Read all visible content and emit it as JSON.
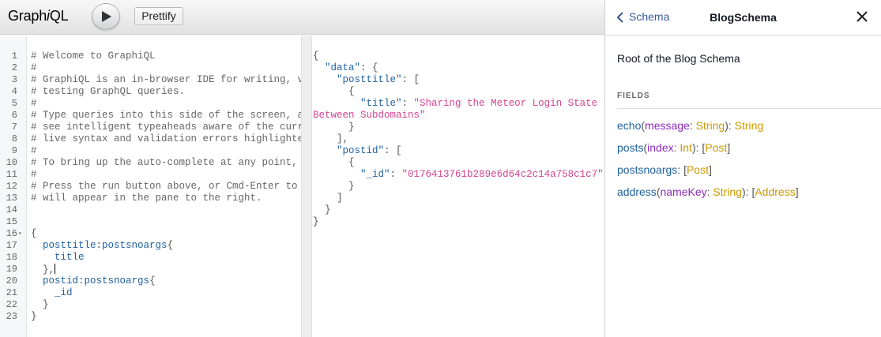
{
  "toolbar": {
    "logo": "GraphiQL",
    "prettify_label": "Prettify"
  },
  "query_editor": {
    "lines": [
      {
        "n": "1",
        "text": "# Welcome to GraphiQL",
        "kind": "comment"
      },
      {
        "n": "2",
        "text": "#",
        "kind": "comment"
      },
      {
        "n": "3",
        "text": "# GraphiQL is an in-browser IDE for writing, val",
        "kind": "comment"
      },
      {
        "n": "4",
        "text": "# testing GraphQL queries.",
        "kind": "comment"
      },
      {
        "n": "5",
        "text": "#",
        "kind": "comment"
      },
      {
        "n": "6",
        "text": "# Type queries into this side of the screen, and",
        "kind": "comment"
      },
      {
        "n": "7",
        "text": "# see intelligent typeaheads aware of the curren",
        "kind": "comment"
      },
      {
        "n": "8",
        "text": "# live syntax and validation errors highlighted",
        "kind": "comment"
      },
      {
        "n": "9",
        "text": "#",
        "kind": "comment"
      },
      {
        "n": "10",
        "text": "# To bring up the auto-complete at any point, ju",
        "kind": "comment"
      },
      {
        "n": "11",
        "text": "#",
        "kind": "comment"
      },
      {
        "n": "12",
        "text": "# Press the run button above, or Cmd-Enter to ex",
        "kind": "comment"
      },
      {
        "n": "13",
        "text": "# will appear in the pane to the right.",
        "kind": "comment"
      },
      {
        "n": "14",
        "text": "",
        "kind": "blank"
      },
      {
        "n": "15",
        "text": "",
        "kind": "blank"
      },
      {
        "n": "16",
        "text": "{",
        "kind": "punct",
        "fold": true
      },
      {
        "n": "17",
        "text": "  posttitle:postsnoargs{",
        "kind": "field"
      },
      {
        "n": "18",
        "text": "    title",
        "kind": "field"
      },
      {
        "n": "19",
        "text": "  },",
        "kind": "punct",
        "cursor": true
      },
      {
        "n": "20",
        "text": "  postid:postsnoargs{",
        "kind": "field"
      },
      {
        "n": "21",
        "text": "    _id",
        "kind": "field"
      },
      {
        "n": "22",
        "text": "  }",
        "kind": "punct"
      },
      {
        "n": "23",
        "text": "}",
        "kind": "punct"
      }
    ]
  },
  "result_viewer": {
    "lines": [
      {
        "text": "{",
        "fold": true
      },
      {
        "pre": "  ",
        "key": "\"data\"",
        "post": ": {",
        "fold": true
      },
      {
        "pre": "    ",
        "key": "\"posttitle\"",
        "post": ": [",
        "fold": true
      },
      {
        "pre": "      {",
        "fold": false
      },
      {
        "pre": "        ",
        "key": "\"title\"",
        "post": ": ",
        "str": "\"Sharing the Meteor Login State"
      },
      {
        "pre": "",
        "str": "Between Subdomains\""
      },
      {
        "pre": "      }"
      },
      {
        "pre": "    ],"
      },
      {
        "pre": "    ",
        "key": "\"postid\"",
        "post": ": [",
        "fold": true
      },
      {
        "pre": "      {"
      },
      {
        "pre": "        ",
        "key": "\"_id\"",
        "post": ": ",
        "str": "\"0176413761b289e6d64c2c14a758c1c7\""
      },
      {
        "pre": "      }"
      },
      {
        "pre": "    ]"
      },
      {
        "pre": "  }"
      },
      {
        "pre": "}"
      }
    ]
  },
  "doc_explorer": {
    "back_label": "Schema",
    "title": "BlogSchema",
    "description": "Root of the Blog Schema",
    "fields_heading": "FIELDS",
    "fields": [
      {
        "name": "echo",
        "args": [
          {
            "arg": "message",
            "type": "String"
          }
        ],
        "returns": "String",
        "list": false
      },
      {
        "name": "posts",
        "args": [
          {
            "arg": "index",
            "type": "Int"
          }
        ],
        "returns": "Post",
        "list": true
      },
      {
        "name": "postsnoargs",
        "args": [],
        "returns": "Post",
        "list": true
      },
      {
        "name": "address",
        "args": [
          {
            "arg": "nameKey",
            "type": "String"
          }
        ],
        "returns": "Address",
        "list": true
      }
    ]
  },
  "colors": {
    "comment": "#666666",
    "field": "#1f61a0",
    "string": "#d64292",
    "arg": "#8b2bb9",
    "type": "#ca9800",
    "link": "#3b5998"
  }
}
